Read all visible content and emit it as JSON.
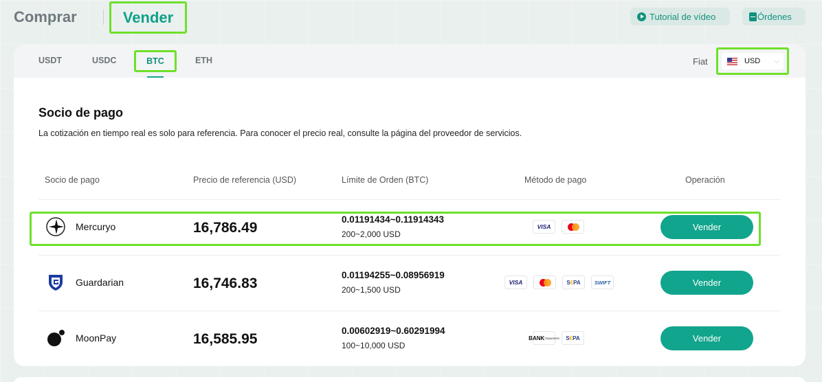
{
  "header": {
    "tab_buy": "Comprar",
    "tab_sell": "Vender",
    "tutorial_label": "Tutorial de vídeo",
    "orders_label": "Órdenes"
  },
  "coins": [
    "USDT",
    "USDC",
    "BTC",
    "ETH"
  ],
  "selected_coin": "BTC",
  "fiat": {
    "label": "Fiat",
    "value": "USD"
  },
  "section": {
    "title": "Socio de pago",
    "description": "La cotización en tiempo real es solo para referencia. Para conocer el precio real, consulte la página del proveedor de servicios."
  },
  "table": {
    "headers": {
      "partner": "Socio de pago",
      "price": "Precio de referencia (USD)",
      "limit": "Límite de Orden (BTC)",
      "method": "Método de pago",
      "operation": "Operación"
    },
    "rows": [
      {
        "partner": "Mercuryo",
        "logo_icon": "mercuryo-logo-icon",
        "price": "16,786.49",
        "limit_range": "0.01191434~0.11914343",
        "limit_fiat": "200~2,000 USD",
        "methods": [
          "VISA",
          "Mastercard"
        ],
        "action": "Vender"
      },
      {
        "partner": "Guardarian",
        "logo_icon": "guardarian-logo-icon",
        "price": "16,746.83",
        "limit_range": "0.01194255~0.08956919",
        "limit_fiat": "200~1,500 USD",
        "methods": [
          "VISA",
          "Mastercard",
          "SEPA",
          "SWIFT"
        ],
        "action": "Vender"
      },
      {
        "partner": "MoonPay",
        "logo_icon": "moonpay-logo-icon",
        "price": "16,585.95",
        "limit_range": "0.00602919~0.60291994",
        "limit_fiat": "100~10,000 USD",
        "methods": [
          "BANK TRANSFER",
          "SEPA"
        ],
        "action": "Vender"
      }
    ]
  },
  "pm_labels": {
    "visa": "VISA",
    "sepa_s": "S",
    "sepa_rest": "PA",
    "sepa_e": "€",
    "swift": "SWIFT",
    "bank": "BANK",
    "transfer": "TRANSFER"
  },
  "colors": {
    "accent": "#12a58d",
    "highlight": "#6ee02a",
    "pill_bg": "#dbe9e6"
  }
}
